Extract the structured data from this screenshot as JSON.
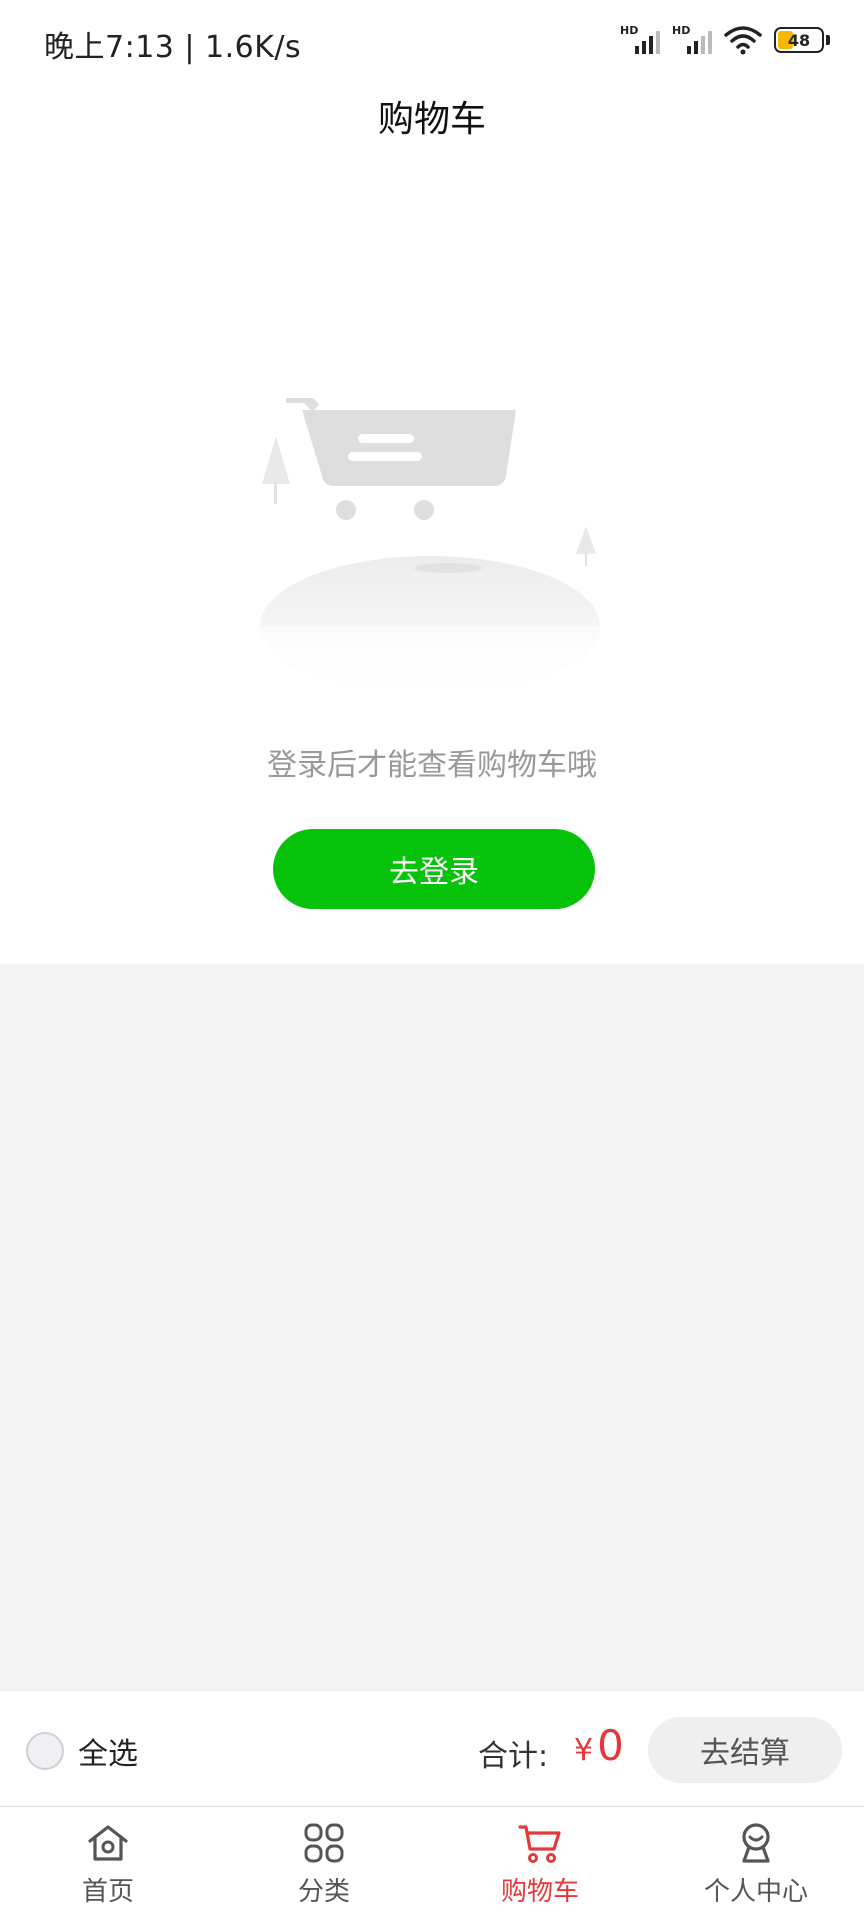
{
  "status_bar": {
    "time_speed": "晚上7:13 | 1.6K/s",
    "sim1_label": "HD",
    "sim2_label": "HD",
    "battery": "48"
  },
  "header": {
    "title": "购物车"
  },
  "empty_state": {
    "illustration": "empty-cart-illustration",
    "message": "登录后才能查看购物车哦",
    "login_button": "去登录"
  },
  "checkout": {
    "select_all": "全选",
    "total_label": "合计:",
    "currency": "¥",
    "total_value": "0",
    "checkout_button": "去结算"
  },
  "tabs": [
    {
      "label": "首页",
      "icon": "home-icon",
      "active": false
    },
    {
      "label": "分类",
      "icon": "category-grid-icon",
      "active": false
    },
    {
      "label": "购物车",
      "icon": "cart-icon",
      "active": true
    },
    {
      "label": "个人中心",
      "icon": "user-icon",
      "active": false
    }
  ],
  "colors": {
    "accent_green": "#07c20b",
    "accent_red": "#e4393c",
    "background": "#f4f4f4"
  }
}
